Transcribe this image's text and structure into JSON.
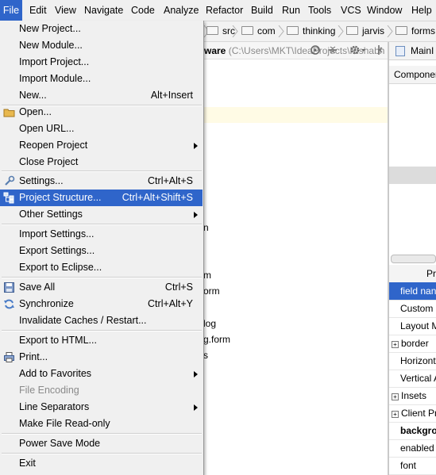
{
  "menubar": [
    "File",
    "Edit",
    "View",
    "Navigate",
    "Code",
    "Analyze",
    "Refactor",
    "Build",
    "Run",
    "Tools",
    "VCS",
    "Window",
    "Help"
  ],
  "breadcrumbs": [
    "src",
    "com",
    "thinking",
    "jarvis",
    "forms"
  ],
  "editor": {
    "title_partial": "ware",
    "title_path": "(C:\\Users\\MKT\\IdeaProjects\\Rishabh Ch",
    "fragments": [
      "n",
      "m",
      "orm",
      "log",
      "g.form",
      "s"
    ]
  },
  "right_panel": {
    "tab_label": "MainI",
    "header": "Componer",
    "prop_header": "Pr",
    "rows": [
      "field nan",
      "Custom",
      "Layout M",
      "border",
      "Horizont",
      "Vertical A",
      "Insets",
      "Client Pr",
      "backgro",
      "enabled",
      "font"
    ]
  },
  "file_menu": {
    "items": [
      {
        "label": "New Project...",
        "shortcut": "",
        "icon": "",
        "submenu": false
      },
      {
        "label": "New Module...",
        "shortcut": "",
        "icon": "",
        "submenu": false
      },
      {
        "label": "Import Project...",
        "shortcut": "",
        "icon": "",
        "submenu": false
      },
      {
        "label": "Import Module...",
        "shortcut": "",
        "icon": "",
        "submenu": false
      },
      {
        "label": "New...",
        "shortcut": "Alt+Insert",
        "icon": "",
        "submenu": false
      },
      {
        "label": "Open...",
        "shortcut": "",
        "icon": "folder-icon",
        "submenu": false
      },
      {
        "label": "Open URL...",
        "shortcut": "",
        "icon": "",
        "submenu": false
      },
      {
        "label": "Reopen Project",
        "shortcut": "",
        "icon": "",
        "submenu": true
      },
      {
        "label": "Close Project",
        "shortcut": "",
        "icon": "",
        "submenu": false
      },
      {
        "label": "Settings...",
        "shortcut": "Ctrl+Alt+S",
        "icon": "wrench-icon",
        "submenu": false
      },
      {
        "label": "Project Structure...",
        "shortcut": "Ctrl+Alt+Shift+S",
        "icon": "project-structure-icon",
        "submenu": false
      },
      {
        "label": "Other Settings",
        "shortcut": "",
        "icon": "",
        "submenu": true
      },
      {
        "label": "Import Settings...",
        "shortcut": "",
        "icon": "",
        "submenu": false
      },
      {
        "label": "Export Settings...",
        "shortcut": "",
        "icon": "",
        "submenu": false
      },
      {
        "label": "Export to Eclipse...",
        "shortcut": "",
        "icon": "",
        "submenu": false
      },
      {
        "label": "Save All",
        "shortcut": "Ctrl+S",
        "icon": "save-icon",
        "submenu": false
      },
      {
        "label": "Synchronize",
        "shortcut": "Ctrl+Alt+Y",
        "icon": "sync-icon",
        "submenu": false
      },
      {
        "label": "Invalidate Caches / Restart...",
        "shortcut": "",
        "icon": "",
        "submenu": false
      },
      {
        "label": "Export to HTML...",
        "shortcut": "",
        "icon": "",
        "submenu": false
      },
      {
        "label": "Print...",
        "shortcut": "",
        "icon": "print-icon",
        "submenu": false
      },
      {
        "label": "Add to Favorites",
        "shortcut": "",
        "icon": "",
        "submenu": true
      },
      {
        "label": "File Encoding",
        "shortcut": "",
        "icon": "",
        "submenu": false
      },
      {
        "label": "Line Separators",
        "shortcut": "",
        "icon": "",
        "submenu": true
      },
      {
        "label": "Make File Read-only",
        "shortcut": "",
        "icon": "",
        "submenu": false
      },
      {
        "label": "Power Save Mode",
        "shortcut": "",
        "icon": "",
        "submenu": false
      },
      {
        "label": "Exit",
        "shortcut": "",
        "icon": "",
        "submenu": false
      }
    ],
    "highlighted": "Project Structure...",
    "disabled": [
      "File Encoding"
    ]
  },
  "colors": {
    "menu_highlight": "#2f65ca",
    "menu_bg": "#f0f0f0",
    "caret_line": "#fffbe5"
  }
}
